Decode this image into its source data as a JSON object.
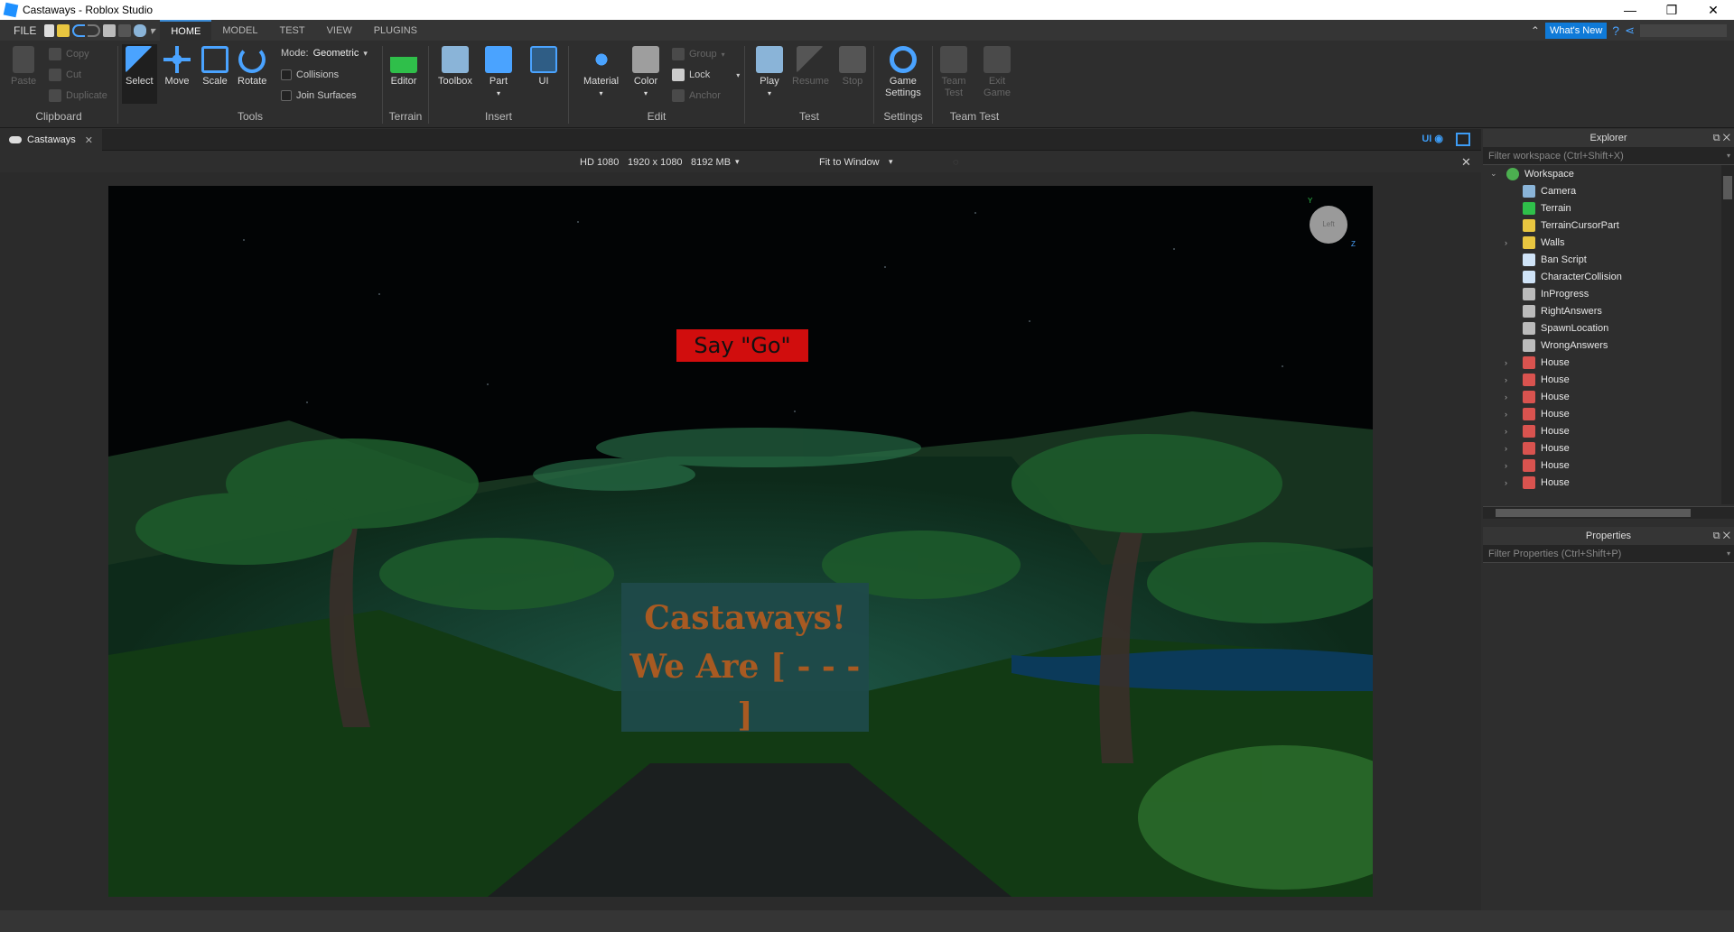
{
  "window": {
    "title": "Castaways - Roblox Studio",
    "min": "—",
    "restore": "❐",
    "close": "✕"
  },
  "menu": {
    "file": "FILE",
    "tabs": [
      "HOME",
      "MODEL",
      "TEST",
      "VIEW",
      "PLUGINS"
    ],
    "active_tab": "HOME",
    "whats_new": "What's New"
  },
  "ribbon": {
    "clipboard": {
      "paste": "Paste",
      "copy": "Copy",
      "cut": "Cut",
      "duplicate": "Duplicate",
      "group_name": "Clipboard"
    },
    "tools": {
      "select": "Select",
      "move": "Move",
      "scale": "Scale",
      "rotate": "Rotate",
      "mode_label": "Mode:",
      "mode_value": "Geometric",
      "collisions": "Collisions",
      "join_surfaces": "Join Surfaces",
      "group_name": "Tools"
    },
    "terrain": {
      "editor": "Editor",
      "group_name": "Terrain"
    },
    "insert": {
      "toolbox": "Toolbox",
      "part": "Part",
      "ui": "UI",
      "group_name": "Insert"
    },
    "edit": {
      "material": "Material",
      "color": "Color",
      "group": "Group",
      "lock": "Lock",
      "anchor": "Anchor",
      "group_name": "Edit"
    },
    "test": {
      "play": "Play",
      "resume": "Resume",
      "stop": "Stop",
      "group_name": "Test"
    },
    "settings": {
      "game_settings_1": "Game",
      "game_settings_2": "Settings",
      "group_name": "Settings"
    },
    "team_test": {
      "team_1": "Team",
      "team_2": "Test",
      "exit_1": "Exit",
      "exit_2": "Game",
      "group_name": "Team Test"
    }
  },
  "document": {
    "tab": "Castaways",
    "ui_toggle": "UI"
  },
  "viewport": {
    "device": "HD 1080",
    "resolution": "1920 x 1080",
    "memory": "8192 MB",
    "fit": "Fit to Window",
    "gui_say_go": "Say \"Go\"",
    "sign_line1": "Castaways!",
    "sign_line2": "We Are [ - - - ]",
    "cube_face": "Left",
    "axis_y": "Y",
    "axis_z": "Z"
  },
  "explorer": {
    "title": "Explorer",
    "filter_placeholder": "Filter workspace (Ctrl+Shift+X)",
    "items": [
      {
        "label": "Workspace",
        "icon": "globe-icon",
        "color": "#4caf50",
        "expand": "⌄"
      },
      {
        "label": "Camera",
        "icon": "camera-icon",
        "color": "#8ab4d8",
        "expand": ""
      },
      {
        "label": "Terrain",
        "icon": "terrain-icon",
        "color": "#2fbf4a",
        "expand": ""
      },
      {
        "label": "TerrainCursorPart",
        "icon": "folder-icon",
        "color": "#e8c640",
        "expand": ""
      },
      {
        "label": "Walls",
        "icon": "folder-icon",
        "color": "#e8c640",
        "expand": "›"
      },
      {
        "label": "Ban Script",
        "icon": "script-icon",
        "color": "#cfe3f7",
        "expand": ""
      },
      {
        "label": "CharacterCollision",
        "icon": "script-icon",
        "color": "#cfe3f7",
        "expand": ""
      },
      {
        "label": "InProgress",
        "icon": "value-icon",
        "color": "#bbbbbb",
        "expand": ""
      },
      {
        "label": "RightAnswers",
        "icon": "value-icon",
        "color": "#bbbbbb",
        "expand": ""
      },
      {
        "label": "SpawnLocation",
        "icon": "spawn-icon",
        "color": "#bbbbbb",
        "expand": ""
      },
      {
        "label": "WrongAnswers",
        "icon": "value-icon",
        "color": "#bbbbbb",
        "expand": ""
      },
      {
        "label": "House",
        "icon": "model-icon",
        "color": "#d9534f",
        "expand": "›"
      },
      {
        "label": "House",
        "icon": "model-icon",
        "color": "#d9534f",
        "expand": "›"
      },
      {
        "label": "House",
        "icon": "model-icon",
        "color": "#d9534f",
        "expand": "›"
      },
      {
        "label": "House",
        "icon": "model-icon",
        "color": "#d9534f",
        "expand": "›"
      },
      {
        "label": "House",
        "icon": "model-icon",
        "color": "#d9534f",
        "expand": "›"
      },
      {
        "label": "House",
        "icon": "model-icon",
        "color": "#d9534f",
        "expand": "›"
      },
      {
        "label": "House",
        "icon": "model-icon",
        "color": "#d9534f",
        "expand": "›"
      },
      {
        "label": "House",
        "icon": "model-icon",
        "color": "#d9534f",
        "expand": "›"
      }
    ]
  },
  "properties": {
    "title": "Properties",
    "filter_placeholder": "Filter Properties (Ctrl+Shift+P)"
  },
  "colors": {
    "accent": "#3b8bd5",
    "whats_new_bg": "#0f7ad8",
    "say_go_bg": "#d10d0d",
    "sign_text": "#a85a22"
  }
}
